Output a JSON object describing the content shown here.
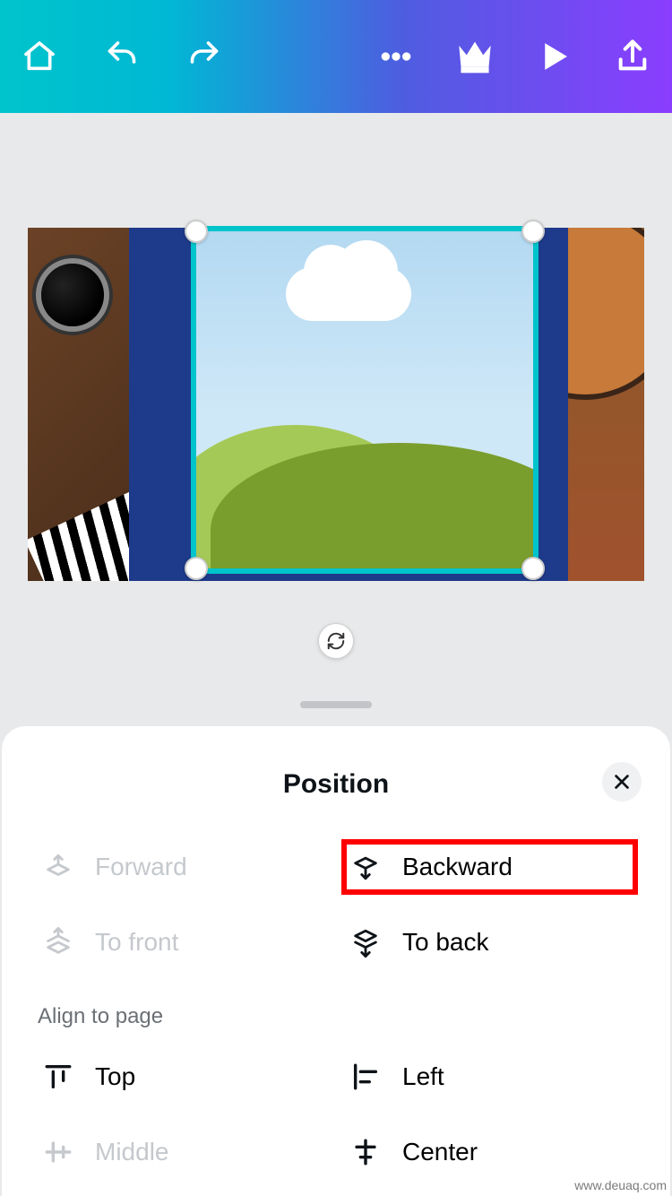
{
  "toolbar": {
    "home_icon": "home",
    "undo_icon": "undo",
    "redo_icon": "redo",
    "more_icon": "more",
    "crown_icon": "crown",
    "play_icon": "play",
    "share_icon": "share"
  },
  "panel": {
    "title": "Position",
    "close_icon": "close",
    "layering": {
      "forward": {
        "label": "Forward",
        "enabled": false,
        "highlighted": false
      },
      "backward": {
        "label": "Backward",
        "enabled": true,
        "highlighted": true
      },
      "to_front": {
        "label": "To front",
        "enabled": false,
        "highlighted": false
      },
      "to_back": {
        "label": "To back",
        "enabled": true,
        "highlighted": false
      }
    },
    "align_section_label": "Align to page",
    "align": {
      "top": {
        "label": "Top",
        "enabled": true
      },
      "left": {
        "label": "Left",
        "enabled": true
      },
      "middle": {
        "label": "Middle",
        "enabled": false
      },
      "center": {
        "label": "Center",
        "enabled": true
      }
    }
  },
  "watermark": "www.deuaq.com"
}
